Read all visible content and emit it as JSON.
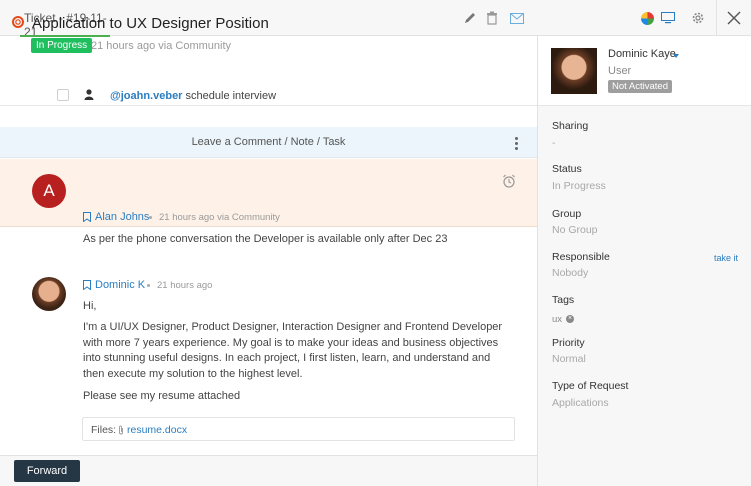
{
  "tab": {
    "label": "Ticket - #19-11-21"
  },
  "ticket": {
    "title": "Application to UX Designer Position",
    "status": "In Progress",
    "meta": "21 hours ago via Community"
  },
  "task": {
    "mention": "@joahn.veber",
    "text": " schedule interview"
  },
  "comment_bar": {
    "label": "Leave a Comment / Note / Task"
  },
  "messages": [
    {
      "initial": "A",
      "author": "Alan Johns",
      "time": "21 hours ago via Community",
      "body": "As per the phone conversation the Developer is available only after Dec 23"
    },
    {
      "author": "Dominic K",
      "time": "21 hours ago",
      "greeting": "Hi,",
      "body": "I'm a UI/UX Designer, Product Designer, Interaction Designer and Frontend Developer with more 7 years experience. My goal is to make your ideas and business objectives into stunning useful designs. In each project, I first listen, learn, and understand and then execute my solution to the highest level.",
      "closing": "Please see my resume attached",
      "files_label": "Files:",
      "file": "resume.docx"
    }
  ],
  "forward_label": "Forward",
  "sidebar": {
    "name": "Dominic Kaye",
    "role": "User",
    "badge": "Not Activated",
    "fields": [
      {
        "label": "Sharing",
        "value": "-"
      },
      {
        "label": "Status",
        "value": "In Progress"
      },
      {
        "label": "Group",
        "value": "No Group"
      },
      {
        "label": "Responsible",
        "value": "Nobody",
        "action": "take it"
      },
      {
        "label": "Tags",
        "tag": "ux"
      },
      {
        "label": "Priority",
        "value": "Normal"
      },
      {
        "label": "Type of Request",
        "value": "Applications"
      }
    ]
  },
  "colors": {
    "status_green": "#1fbf60",
    "link_blue": "#2a7dc1",
    "highlight_bg": "#fdf1e8",
    "comment_bar_bg": "#ebf5fb",
    "forward_btn": "#253645",
    "avatar_red": "#b81f1f"
  },
  "icons": [
    "pencil-icon",
    "trash-icon",
    "envelope-icon",
    "pie-chart-icon",
    "monitor-icon",
    "gear-icon",
    "close-icon"
  ]
}
